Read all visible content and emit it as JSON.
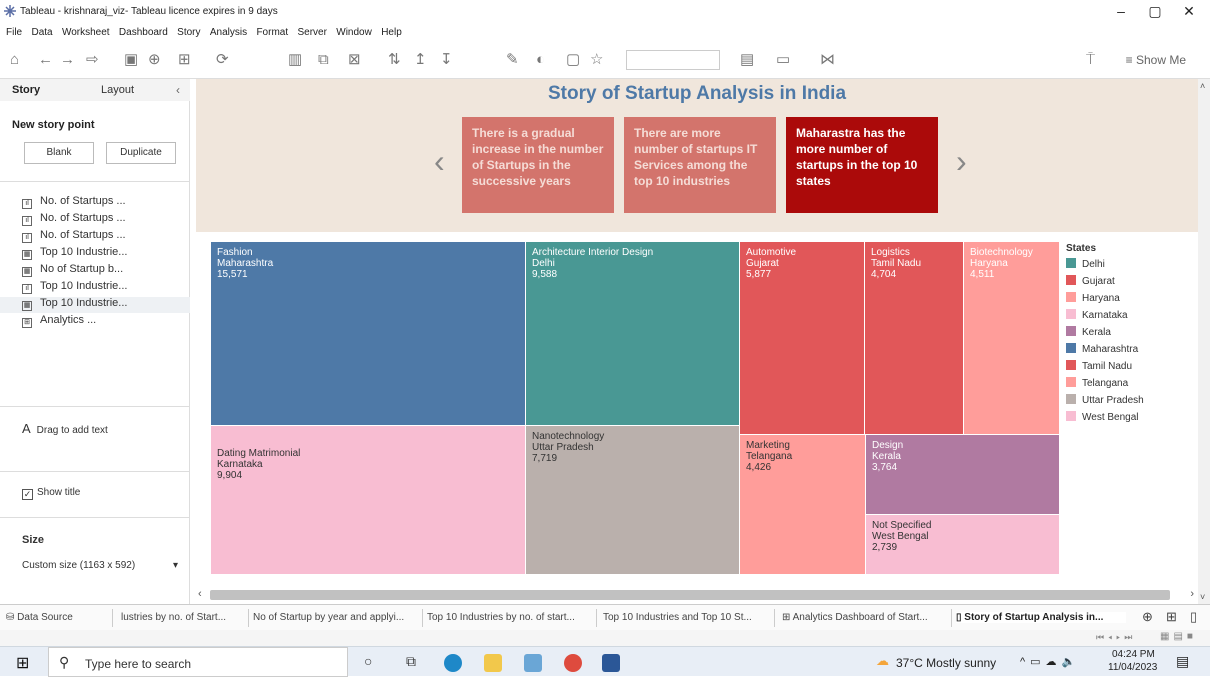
{
  "window": {
    "title": "Tableau - krishnaraj_viz- Tableau licence expires in 9 days",
    "min": "–",
    "max": "▢",
    "close": "✕"
  },
  "menu": [
    "File",
    "Data",
    "Worksheet",
    "Dashboard",
    "Story",
    "Analysis",
    "Format",
    "Server",
    "Window",
    "Help"
  ],
  "toolbar": {
    "show_me": "Show Me"
  },
  "sidebar": {
    "tab_story": "Story",
    "tab_layout": "Layout",
    "collapse": "‹",
    "new_point": "New story point",
    "blank": "Blank",
    "duplicate": "Duplicate",
    "sheets": [
      {
        "label": "No. of Startups ...",
        "icon": "bar-chart-icon"
      },
      {
        "label": "No. of Startups ...",
        "icon": "bar-chart-icon"
      },
      {
        "label": "No. of Startups ...",
        "icon": "bar-chart-icon"
      },
      {
        "label": "Top 10 Industrie...",
        "icon": "sheet-filter-icon"
      },
      {
        "label": "No of Startup b...",
        "icon": "sheet-filter-icon"
      },
      {
        "label": "Top 10 Industrie...",
        "icon": "bar-chart-icon"
      },
      {
        "label": "Top 10 Industrie...",
        "icon": "sheet-filter-icon"
      },
      {
        "label": "Analytics ...",
        "icon": "dashboard-icon"
      }
    ],
    "drag_text": "Drag to add text",
    "show_title": "Show title",
    "size_label": "Size",
    "size_value": "Custom size (1163 x 592)"
  },
  "story": {
    "title": "Story of Startup Analysis in India",
    "points": [
      {
        "text": "There is a gradual increase in the number of Startups in the successive years"
      },
      {
        "text": "There are more number of  startups IT Services among the top 10 industries"
      },
      {
        "text": "Maharastra has the more number of startups in the top 10 states"
      }
    ]
  },
  "treemap": {
    "tiles": [
      {
        "industry": "Fashion",
        "state": "Maharashtra",
        "value": "15,571",
        "color": "#4e79a7"
      },
      {
        "industry": "Architecture Interior Design",
        "state": "Delhi",
        "value": "9,588",
        "color": "#499894"
      },
      {
        "industry": "Automotive",
        "state": "Gujarat",
        "value": "5,877",
        "color": "#e15759"
      },
      {
        "industry": "Logistics",
        "state": "Tamil Nadu",
        "value": "4,704",
        "color": "#e15759"
      },
      {
        "industry": "Biotechnology",
        "state": "Haryana",
        "value": "4,511",
        "color": "#ff9d9a"
      },
      {
        "industry": "Dating Matrimonial",
        "state": "Karnataka",
        "value": "9,904",
        "color": "#f8bdd2"
      },
      {
        "industry": "Nanotechnology",
        "state": "Uttar Pradesh",
        "value": "7,719",
        "color": "#bab0ac"
      },
      {
        "industry": "Marketing",
        "state": "Telangana",
        "value": "4,426",
        "color": "#ff9d9a"
      },
      {
        "industry": "Design",
        "state": "Kerala",
        "value": "3,764",
        "color": "#b07aa1"
      },
      {
        "industry": "Not Specified",
        "state": "West Bengal",
        "value": "2,739",
        "color": "#f8bdd2"
      }
    ]
  },
  "legend": {
    "title": "States",
    "items": [
      {
        "label": "Delhi",
        "color": "#499894"
      },
      {
        "label": "Gujarat",
        "color": "#e15759"
      },
      {
        "label": "Haryana",
        "color": "#ff9d9a"
      },
      {
        "label": "Karnataka",
        "color": "#f8bdd2"
      },
      {
        "label": "Kerala",
        "color": "#b07aa1"
      },
      {
        "label": "Maharashtra",
        "color": "#4e79a7"
      },
      {
        "label": "Tamil Nadu",
        "color": "#e15759"
      },
      {
        "label": "Telangana",
        "color": "#ff9d9a"
      },
      {
        "label": "Uttar Pradesh",
        "color": "#bab0ac"
      },
      {
        "label": "West Bengal",
        "color": "#f8bdd2"
      }
    ]
  },
  "sheet_tabs": [
    "Data Source",
    "lustries by no. of Start...",
    "No of Startup by year and applyi...",
    "Top 10 Industries by no. of start...",
    "Top 10 Industries and Top 10 St...",
    "Analytics Dashboard of Start...",
    "Story of Startup Analysis in..."
  ],
  "taskbar": {
    "search": "Type here to search",
    "weather": "37°C  Mostly sunny",
    "time": "04:24 PM",
    "date": "11/04/2023"
  }
}
